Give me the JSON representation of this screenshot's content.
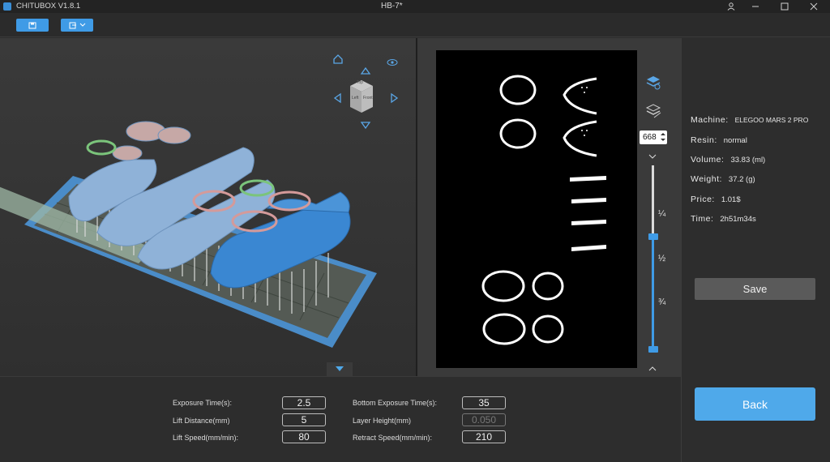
{
  "window": {
    "app_name": "CHITUBOX V1.8.1",
    "doc_title": "HB-7*"
  },
  "slice_view": {
    "layer": "668",
    "fractions": [
      "¼",
      "½",
      "¾"
    ]
  },
  "viewcube": {
    "top_label": "Top",
    "left_label": "Left",
    "front_label": "Front"
  },
  "info": {
    "machine_label": "Machine:",
    "machine_value": "ELEGOO MARS 2 PRO",
    "resin_label": "Resin:",
    "resin_value": "normal",
    "volume_label": "Volume:",
    "volume_value": "33.83  (ml)",
    "weight_label": "Weight:",
    "weight_value": "37.2  (g)",
    "price_label": "Price:",
    "price_value": "1.01$",
    "time_label": "Time:",
    "time_value": "2h51m34s"
  },
  "buttons": {
    "save": "Save",
    "back": "Back"
  },
  "params": {
    "exposure_time_label": "Exposure Time(s):",
    "exposure_time": "2.5",
    "lift_distance_label": "Lift Distance(mm)",
    "lift_distance": "5",
    "lift_speed_label": "Lift Speed(mm/min):",
    "lift_speed": "80",
    "bottom_exposure_label": "Bottom Exposure Time(s):",
    "bottom_exposure": "35",
    "layer_height_label": "Layer Height(mm)",
    "layer_height": "0.050",
    "retract_speed_label": "Retract Speed(mm/min):",
    "retract_speed": "210"
  }
}
